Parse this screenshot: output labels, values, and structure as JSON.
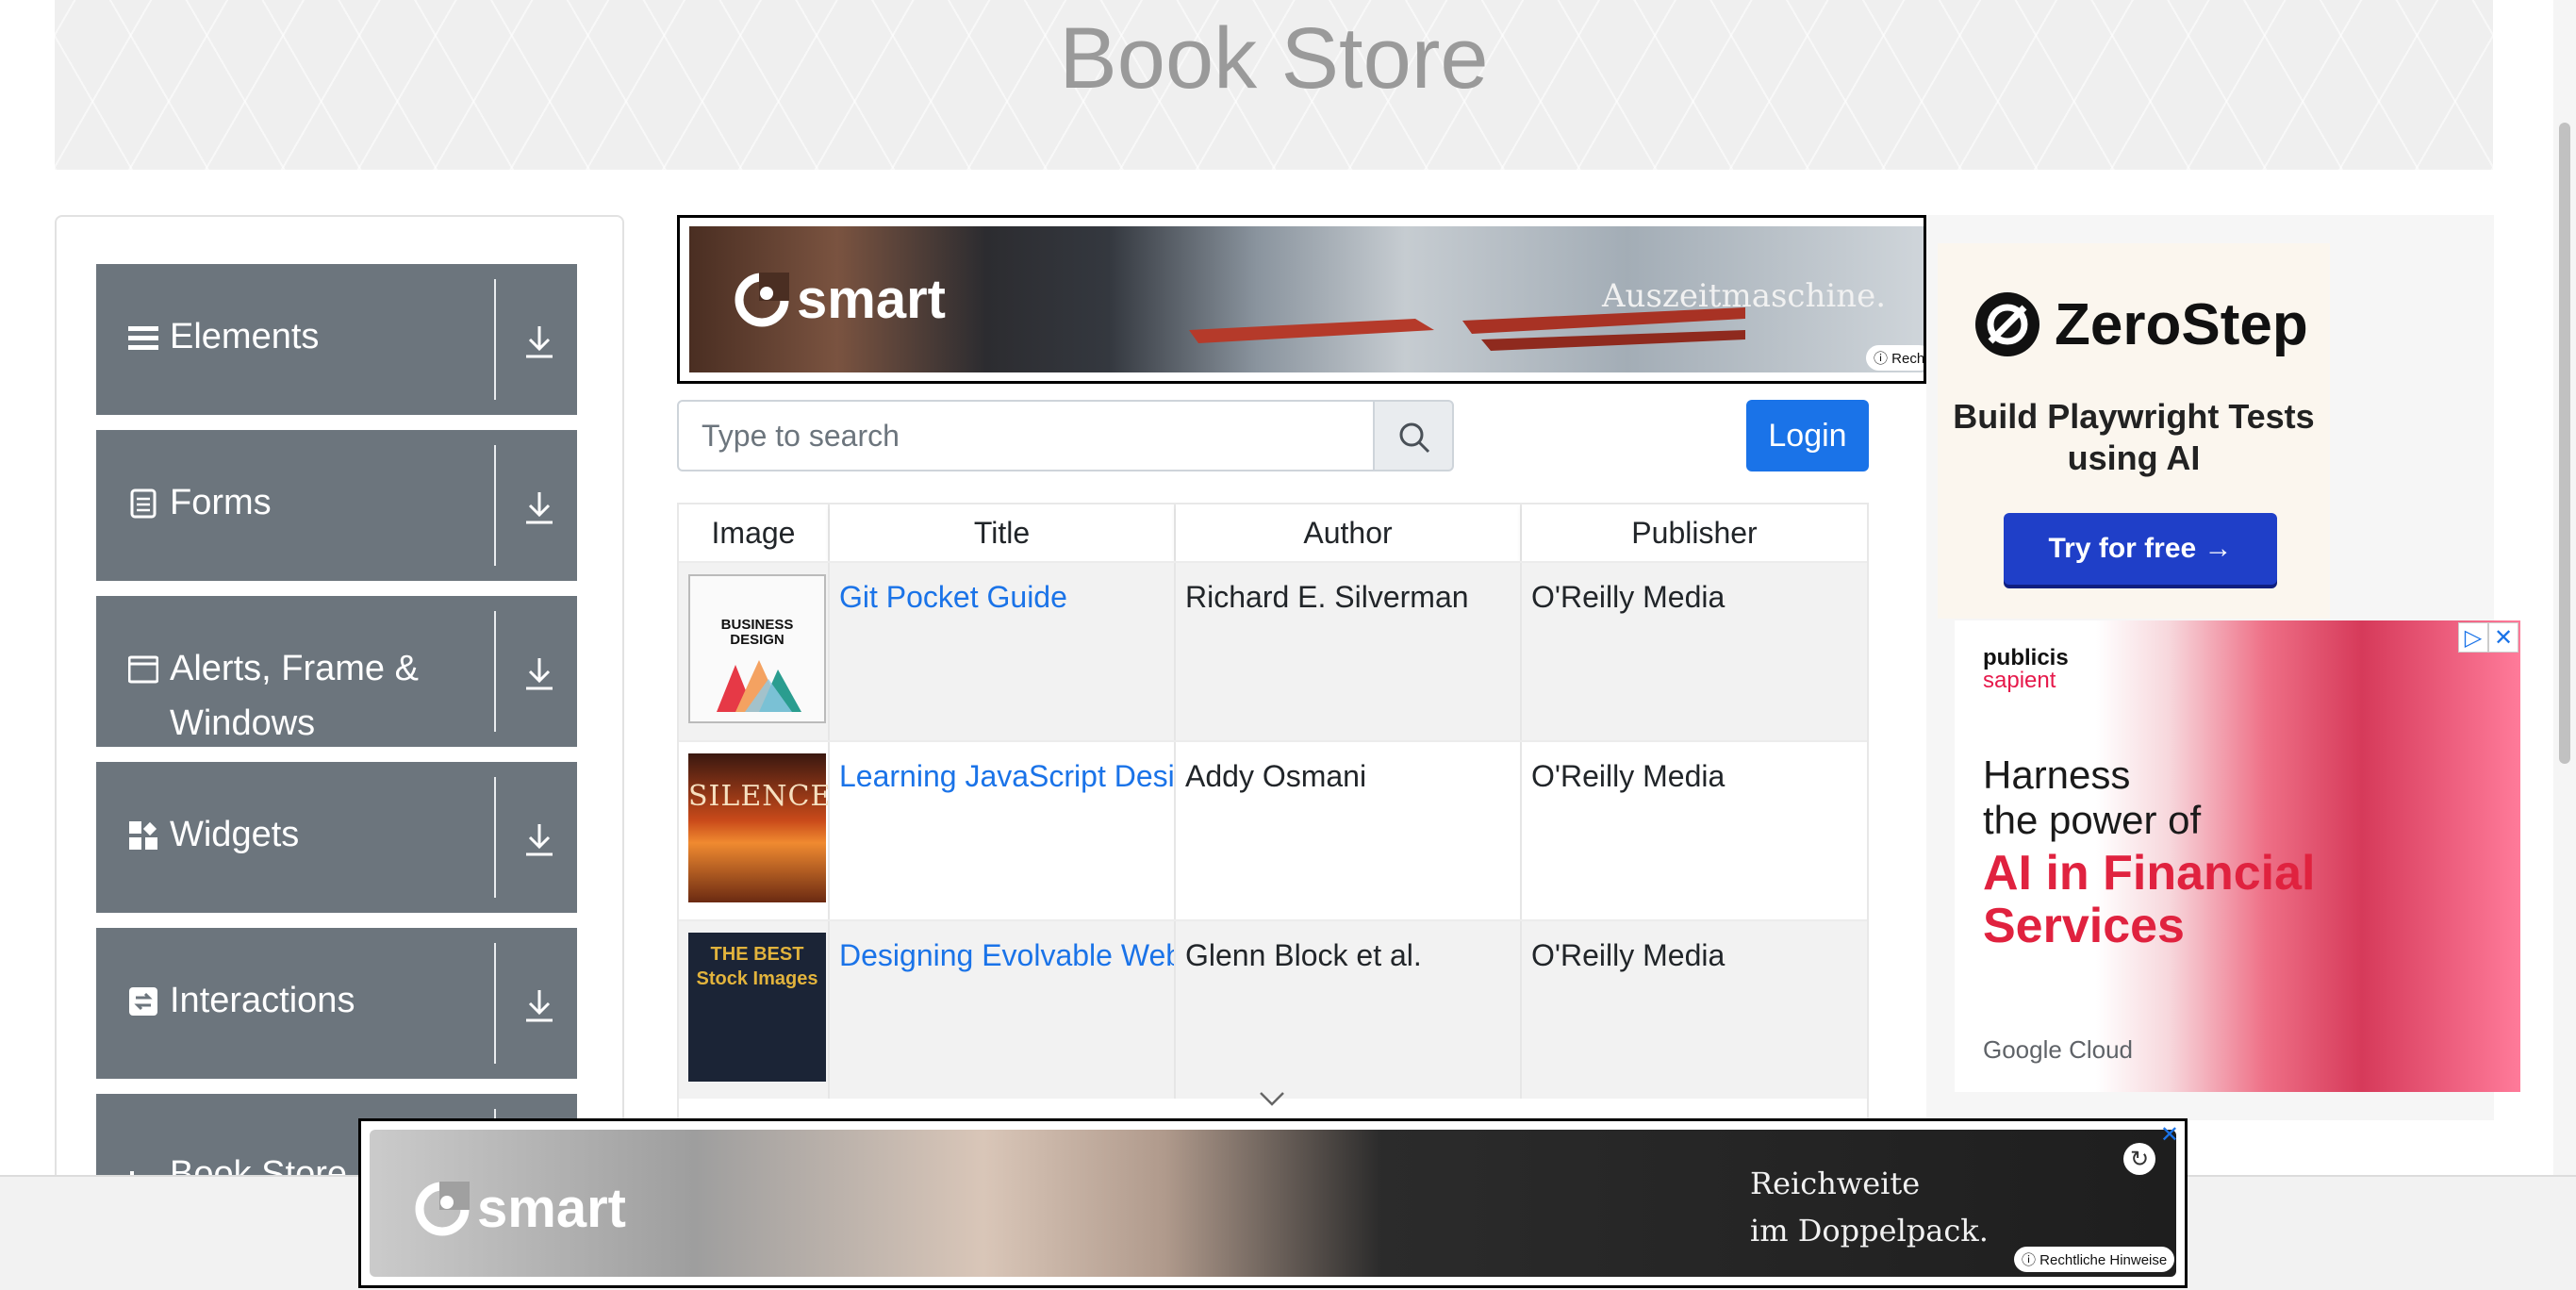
{
  "header": {
    "title": "Book Store"
  },
  "sidebar": {
    "items": [
      {
        "label": "Elements",
        "icon": "hamburger-icon"
      },
      {
        "label": "Forms",
        "icon": "document-icon"
      },
      {
        "label": "Alerts, Frame & Windows",
        "icon": "window-icon"
      },
      {
        "label": "Widgets",
        "icon": "widgets-icon"
      },
      {
        "label": "Interactions",
        "icon": "interactions-icon"
      },
      {
        "label": "Book Store",
        "icon": "bar-chart-icon"
      }
    ]
  },
  "ad_top": {
    "brand": "smart",
    "tagline": "Auszeitmaschine.",
    "legal": "Rech"
  },
  "search": {
    "placeholder": "Type to search"
  },
  "login": {
    "label": "Login"
  },
  "table": {
    "columns": [
      "Image",
      "Title",
      "Author",
      "Publisher"
    ],
    "rows": [
      {
        "title": "Git Pocket Guide",
        "author": "Richard E. Silverman",
        "publisher": "O'Reilly Media",
        "cover_text": "BUSINESS DESIGN"
      },
      {
        "title": "Learning JavaScript Design Patterns",
        "author": "Addy Osmani",
        "publisher": "O'Reilly Media",
        "cover_text": "SILENCE"
      },
      {
        "title": "Designing Evolvable Web APIs with ASP.NET",
        "author": "Glenn Block et al.",
        "publisher": "O'Reilly Media",
        "cover_text": "THE BEST Stock Images"
      }
    ]
  },
  "ad_right": {
    "zerostep": {
      "brand": "ZeroStep",
      "headline": "Build Playwright Tests using AI",
      "cta": "Try for free →"
    },
    "publicis": {
      "brand_line1": "publicis",
      "brand_line2": "sapient",
      "line1": "Harness",
      "line2": "the power of",
      "highlight": "AI in Financial Services",
      "footer": "Google Cloud"
    }
  },
  "ad_bottom": {
    "brand": "smart",
    "line1": "Reichweite",
    "line2": "im Doppelpack.",
    "legal": "Rechtliche Hinweise"
  },
  "colors": {
    "sidebar_bg": "#6c757d",
    "link": "#1a73e8",
    "login_bg": "#1a73e8",
    "zerostep_cta": "#1f3fc8",
    "publicis_red": "#e0223f"
  }
}
